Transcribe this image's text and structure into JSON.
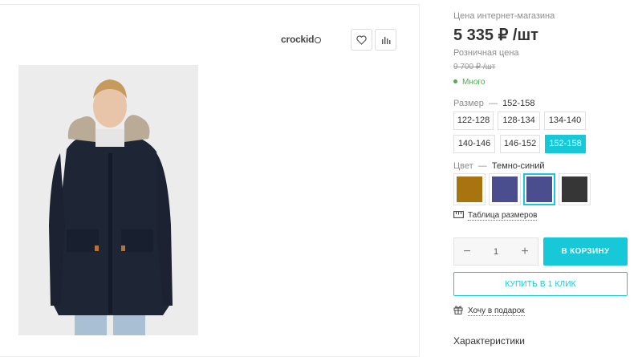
{
  "left": {
    "brand": "crockid",
    "wishlist_icon": "heart-icon",
    "compare_icon": "bar-chart-icon",
    "photo_alt_icon": "product-photo-jacket"
  },
  "pricing": {
    "online_label": "Цена интернет-магазина",
    "online_price": "5 335 ₽ /шт",
    "retail_label": "Розничная цена",
    "retail_price": "9 700 ₽ /шт",
    "stock": "Много"
  },
  "size": {
    "label": "Размер",
    "separator": "—",
    "selected": "152-158",
    "options": [
      "122-128",
      "128-134",
      "134-140",
      "140-146",
      "146-152",
      "152-158"
    ]
  },
  "color": {
    "label": "Цвет",
    "separator": "—",
    "selected": "Темно-синий",
    "swatches": [
      "#a8740f",
      "#4a4d8e",
      "#4a4d8e",
      "#363636"
    ]
  },
  "size_table_link": "Таблица размеров",
  "quantity": {
    "minus": "−",
    "value": "1",
    "plus": "+"
  },
  "buttons": {
    "cart": "В КОРЗИНУ",
    "one_click": "КУПИТЬ В 1 КЛИК"
  },
  "gift_link": "Хочу в подарок",
  "characteristics_title": "Характеристики",
  "colors": {
    "accent": "#17c8d8",
    "stock_green": "#4cae4c"
  }
}
